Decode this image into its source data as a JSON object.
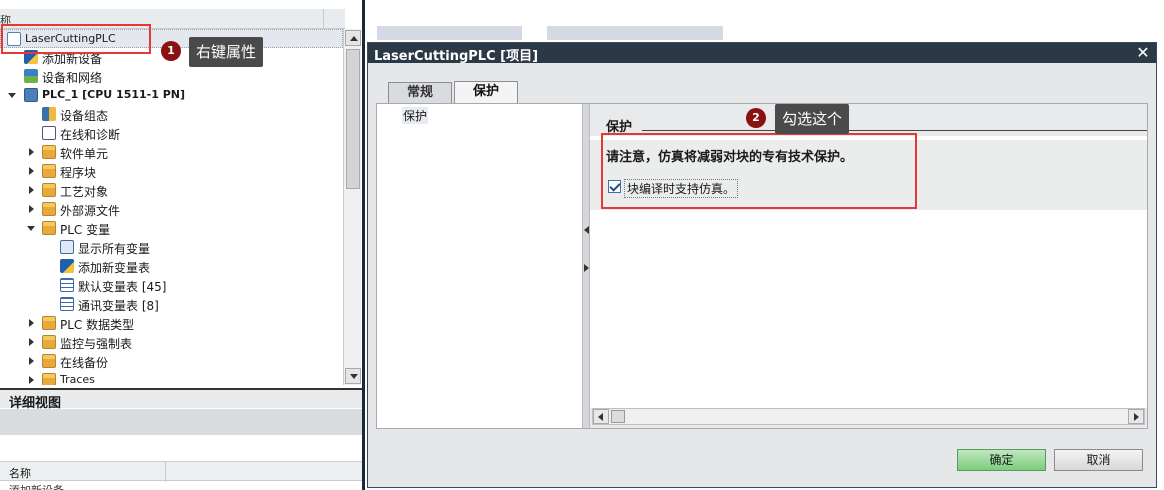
{
  "tree": {
    "header_label": "称",
    "items": [
      {
        "label": "LaserCuttingPLC",
        "icon": "project-doc-icon"
      },
      {
        "label": "添加新设备",
        "icon": "add-device-icon"
      },
      {
        "label": "设备和网络",
        "icon": "devices-networks-icon"
      },
      {
        "label": "PLC_1 [CPU 1511-1 PN]",
        "icon": "plc-cpu-icon"
      },
      {
        "label": "设备组态",
        "icon": "device-config-icon"
      },
      {
        "label": "在线和诊断",
        "icon": "online-diagnostics-icon"
      },
      {
        "label": "软件单元",
        "icon": "software-units-icon"
      },
      {
        "label": "程序块",
        "icon": "program-blocks-icon"
      },
      {
        "label": "工艺对象",
        "icon": "technology-objects-icon"
      },
      {
        "label": "外部源文件",
        "icon": "external-sources-icon"
      },
      {
        "label": "PLC 变量",
        "icon": "plc-tags-folder-icon"
      },
      {
        "label": "显示所有变量",
        "icon": "show-all-tags-icon"
      },
      {
        "label": "添加新变量表",
        "icon": "add-tag-table-icon"
      },
      {
        "label": "默认变量表 [45]",
        "icon": "tag-table-icon"
      },
      {
        "label": "通讯变量表 [8]",
        "icon": "tag-table-icon"
      },
      {
        "label": "PLC 数据类型",
        "icon": "plc-data-types-icon"
      },
      {
        "label": "监控与强制表",
        "icon": "watch-force-tables-icon"
      },
      {
        "label": "在线备份",
        "icon": "online-backups-icon"
      },
      {
        "label": "Traces",
        "icon": "traces-icon"
      }
    ]
  },
  "detail_view": {
    "title": "详细视图",
    "column_name": "名称",
    "row_partial": "添加新设备"
  },
  "dialog": {
    "title": "LaserCuttingPLC [项目]",
    "close_glyph": "✕",
    "tabs": [
      {
        "label": "常规",
        "active": false
      },
      {
        "label": "保护",
        "active": true
      }
    ],
    "nav_item": "保护",
    "section_title": "保护",
    "notice": "请注意，仿真将减弱对块的专有技术保护。",
    "checkbox_label": "块编译时支持仿真。",
    "checkbox_checked": true,
    "ok_label": "确定",
    "cancel_label": "取消"
  },
  "annotations": [
    {
      "number": "1",
      "text": "右键属性"
    },
    {
      "number": "2",
      "text": "勾选这个"
    }
  ],
  "colors": {
    "annotation_red": "#e53935",
    "callout_bg": "#4a4a4a",
    "ok_green": "#7dcc7d",
    "titlebar": "#2b3846"
  }
}
